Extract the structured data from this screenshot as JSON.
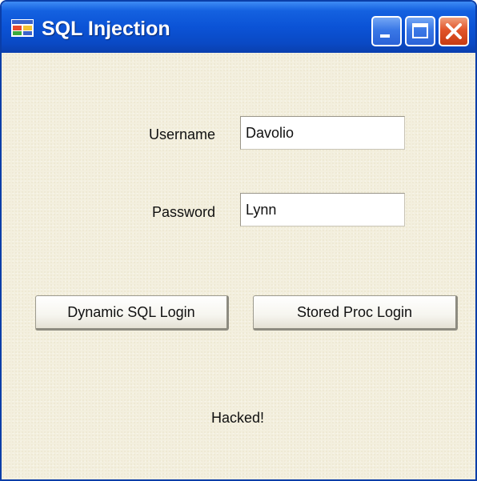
{
  "window": {
    "title": "SQL Injection",
    "icon": "app-window-icon",
    "controls": {
      "minimize_icon": "minimize-icon",
      "maximize_icon": "maximize-icon",
      "close_icon": "close-icon"
    },
    "colors": {
      "titlebar": "#0b53d6",
      "client_background": "#f3efde",
      "close_button": "#e1552a"
    }
  },
  "form": {
    "username": {
      "label": "Username",
      "value": "Davolio"
    },
    "password": {
      "label": "Password",
      "value": "Lynn"
    },
    "buttons": {
      "dynamic_sql_login": "Dynamic SQL Login",
      "stored_proc_login": "Stored Proc Login"
    },
    "status": "Hacked!"
  }
}
